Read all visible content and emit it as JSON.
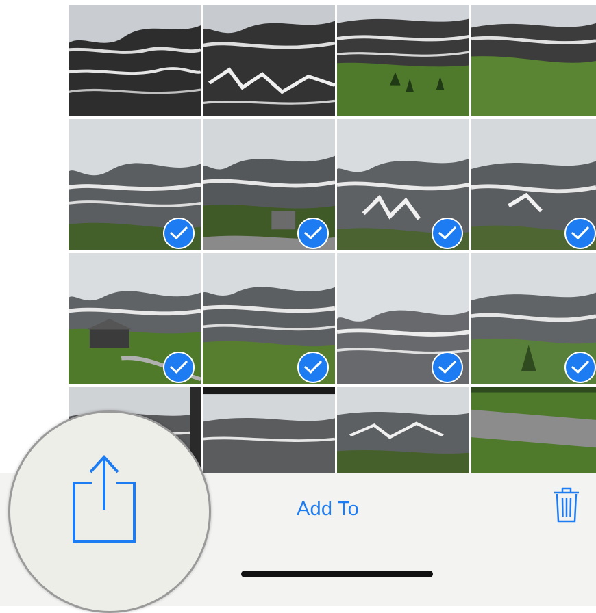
{
  "photos": {
    "columns": 4,
    "rows_visible": 4,
    "selected": [
      false,
      false,
      false,
      false,
      true,
      true,
      true,
      true,
      true,
      true,
      true,
      true,
      false,
      false,
      false,
      false
    ]
  },
  "toolbar": {
    "share_icon": "share-icon",
    "add_to_label": "Add To",
    "trash_icon": "trash-icon"
  },
  "colors": {
    "accent": "#1e7cf2",
    "toolbar_bg": "#f3f3f1",
    "home_indicator": "#111111"
  }
}
